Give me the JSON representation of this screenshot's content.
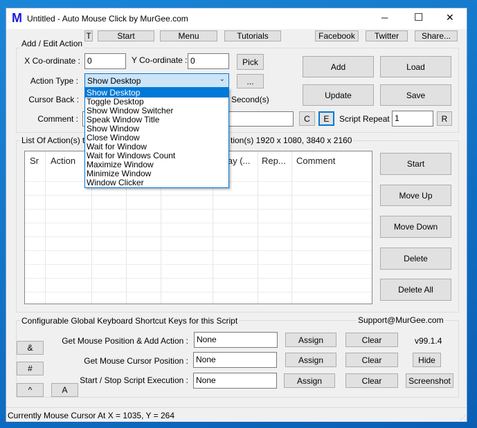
{
  "title": {
    "app_icon": "M",
    "text": "Untitled - Auto Mouse Click by MurGee.com",
    "minimize": "─",
    "maximize": "☐",
    "close": "✕"
  },
  "toolbar": {
    "t": "T",
    "start": "Start",
    "menu": "Menu",
    "tutorials": "Tutorials",
    "facebook": "Facebook",
    "twitter": "Twitter",
    "share": "Share..."
  },
  "edit": {
    "group_title": "Add / Edit Action",
    "x_label": "X Co-ordinate :",
    "x_value": "0",
    "y_label": "Y Co-ordinate :",
    "y_value": "0",
    "pick": "Pick",
    "action_type_label": "Action Type :",
    "action_type_value": "Show Desktop",
    "more": "...",
    "cursor_back_label": "Cursor Back :",
    "seconds": "Second(s)",
    "comment_label": "Comment :",
    "comment_value": "",
    "c": "C",
    "e": "E",
    "script_repeat_label": "Script Repeat :",
    "script_repeat_value": "1",
    "r": "R",
    "add": "Add",
    "load": "Load",
    "update": "Update",
    "save": "Save"
  },
  "dropdown": {
    "items": [
      "Show Desktop",
      "Toggle Desktop",
      "Show Window Switcher",
      "Speak Window Title",
      "Show Window",
      "Close Window",
      "Wait for Window",
      "Wait for Windows Count",
      "Maximize Window",
      "Minimize Window",
      "Window Clicker"
    ],
    "selected": 0
  },
  "list": {
    "title_left": "List Of Action(s) to ",
    "title_right": "tion(s) 1920 x 1080, 3840 x 2160",
    "headers": {
      "sr": "Sr",
      "action": "Action",
      "delay": "lay (...",
      "repeat": "Rep...",
      "comment": "Comment"
    },
    "start": "Start",
    "move_up": "Move Up",
    "move_down": "Move Down",
    "delete": "Delete",
    "delete_all": "Delete All"
  },
  "shortcuts": {
    "group_title": "Configurable Global Keyboard Shortcut Keys for this Script",
    "support": "Support@MurGee.com",
    "version": "v99.1.4",
    "rows": [
      {
        "label": "Get Mouse Position & Add Action :",
        "value": "None",
        "assign": "Assign",
        "clear": "Clear"
      },
      {
        "label": "Get Mouse Cursor Position :",
        "value": "None",
        "assign": "Assign",
        "clear": "Clear"
      },
      {
        "label": "Start / Stop Script Execution :",
        "value": "None",
        "assign": "Assign",
        "clear": "Clear"
      }
    ],
    "hide": "Hide",
    "screenshot": "Screenshot",
    "amp": "&",
    "hash": "#",
    "caret": "^",
    "a": "A"
  },
  "status": {
    "text": "Currently Mouse Cursor At X = 1035, Y = 264"
  },
  "colors": {
    "accent": "#0078d7",
    "logo": "#1a1adc"
  }
}
